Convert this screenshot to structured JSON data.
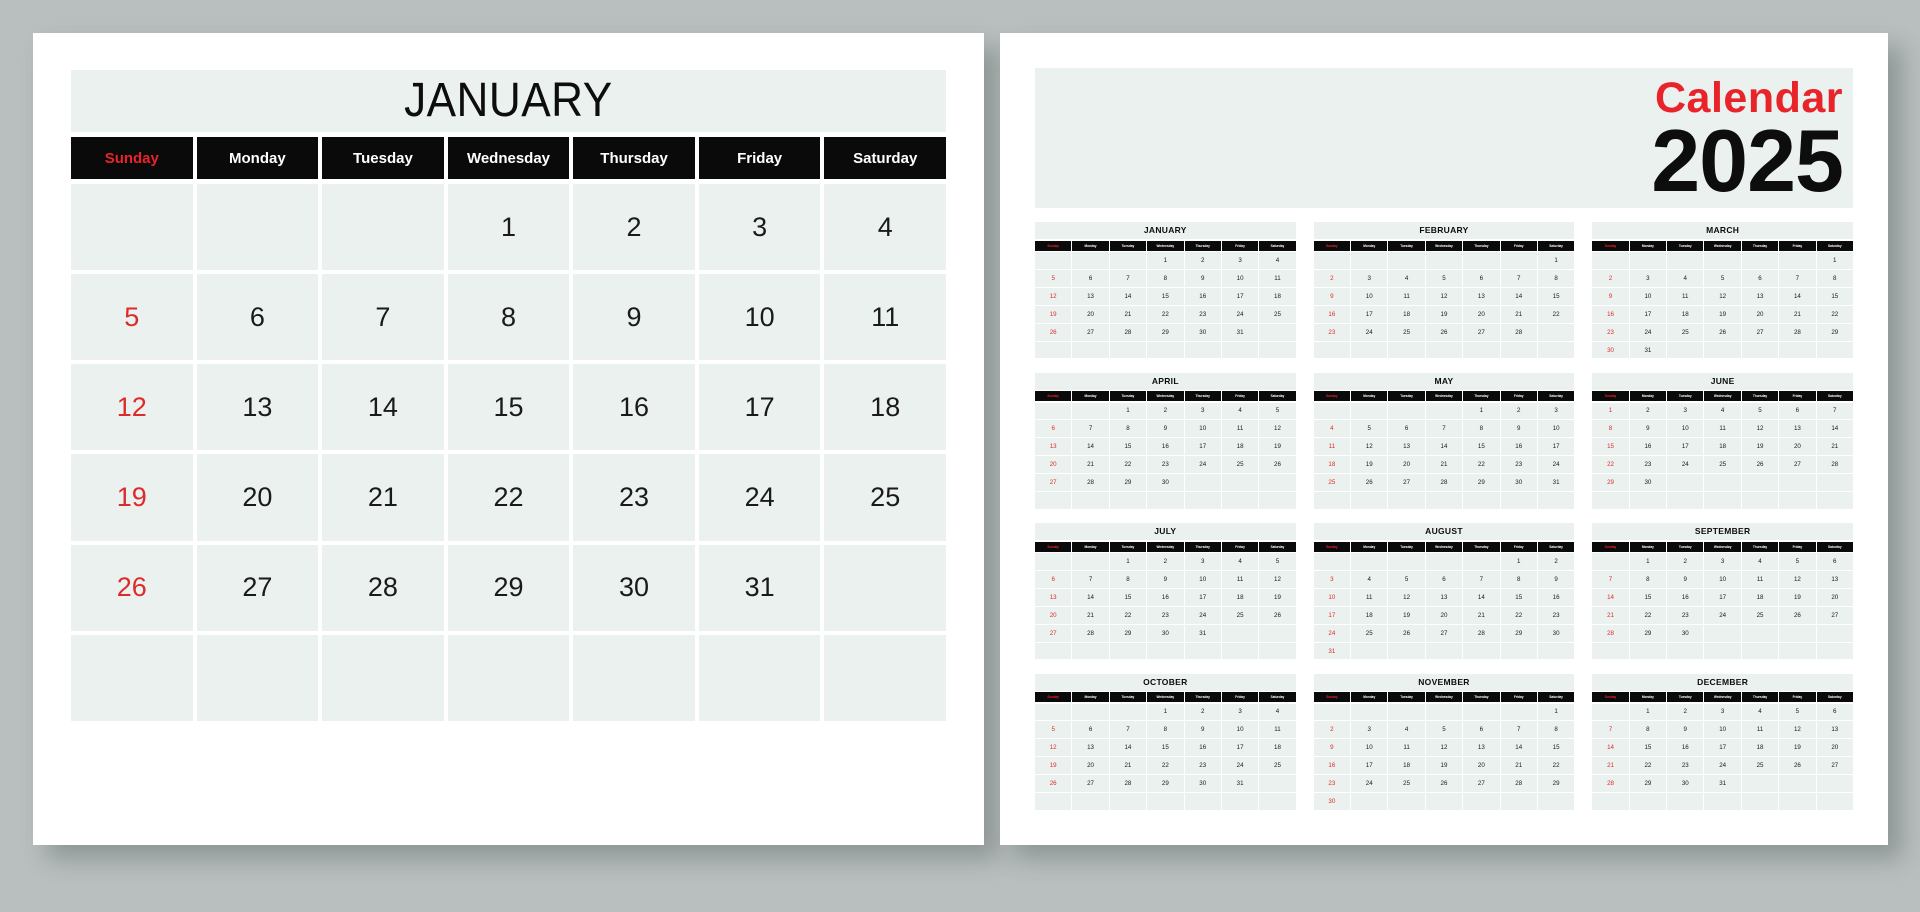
{
  "theme": {
    "background": "#b8bfbe",
    "card": "#ffffff",
    "cell": "#ebf1ef",
    "header_bar": "#0a0a0a",
    "accent_red": "#e8242a",
    "sunday_red": "#dc2b2b",
    "text": "#1a1a1a"
  },
  "main_month": {
    "title": "JANUARY",
    "weekdays": [
      "Sunday",
      "Monday",
      "Tuesday",
      "Wednesday",
      "Thursday",
      "Friday",
      "Saturday"
    ],
    "weeks": [
      [
        "",
        "",
        "",
        "1",
        "2",
        "3",
        "4"
      ],
      [
        "5",
        "6",
        "7",
        "8",
        "9",
        "10",
        "11"
      ],
      [
        "12",
        "13",
        "14",
        "15",
        "16",
        "17",
        "18"
      ],
      [
        "19",
        "20",
        "21",
        "22",
        "23",
        "24",
        "25"
      ],
      [
        "26",
        "27",
        "28",
        "29",
        "30",
        "31",
        ""
      ],
      [
        "",
        "",
        "",
        "",
        "",
        "",
        ""
      ]
    ]
  },
  "year_panel": {
    "word": "Calendar",
    "year": "2025",
    "mini_weekdays": [
      "Sunday",
      "Monday",
      "Tuesday",
      "Wednesday",
      "Thursday",
      "Friday",
      "Saturday"
    ],
    "months": [
      {
        "name": "JANUARY",
        "weeks": [
          [
            "",
            "",
            "",
            "1",
            "2",
            "3",
            "4"
          ],
          [
            "5",
            "6",
            "7",
            "8",
            "9",
            "10",
            "11"
          ],
          [
            "12",
            "13",
            "14",
            "15",
            "16",
            "17",
            "18"
          ],
          [
            "19",
            "20",
            "21",
            "22",
            "23",
            "24",
            "25"
          ],
          [
            "26",
            "27",
            "28",
            "29",
            "30",
            "31",
            ""
          ],
          [
            "",
            "",
            "",
            "",
            "",
            "",
            ""
          ]
        ]
      },
      {
        "name": "FEBRUARY",
        "weeks": [
          [
            "",
            "",
            "",
            "",
            "",
            "",
            "1"
          ],
          [
            "2",
            "3",
            "4",
            "5",
            "6",
            "7",
            "8"
          ],
          [
            "9",
            "10",
            "11",
            "12",
            "13",
            "14",
            "15"
          ],
          [
            "16",
            "17",
            "18",
            "19",
            "20",
            "21",
            "22"
          ],
          [
            "23",
            "24",
            "25",
            "26",
            "27",
            "28",
            ""
          ],
          [
            "",
            "",
            "",
            "",
            "",
            "",
            ""
          ]
        ]
      },
      {
        "name": "MARCH",
        "weeks": [
          [
            "",
            "",
            "",
            "",
            "",
            "",
            "1"
          ],
          [
            "2",
            "3",
            "4",
            "5",
            "6",
            "7",
            "8"
          ],
          [
            "9",
            "10",
            "11",
            "12",
            "13",
            "14",
            "15"
          ],
          [
            "16",
            "17",
            "18",
            "19",
            "20",
            "21",
            "22"
          ],
          [
            "23",
            "24",
            "25",
            "26",
            "27",
            "28",
            "29"
          ],
          [
            "30",
            "31",
            "",
            "",
            "",
            "",
            ""
          ]
        ]
      },
      {
        "name": "APRIL",
        "weeks": [
          [
            "",
            "",
            "1",
            "2",
            "3",
            "4",
            "5"
          ],
          [
            "6",
            "7",
            "8",
            "9",
            "10",
            "11",
            "12"
          ],
          [
            "13",
            "14",
            "15",
            "16",
            "17",
            "18",
            "19"
          ],
          [
            "20",
            "21",
            "22",
            "23",
            "24",
            "25",
            "26"
          ],
          [
            "27",
            "28",
            "29",
            "30",
            "",
            "",
            ""
          ],
          [
            "",
            "",
            "",
            "",
            "",
            "",
            ""
          ]
        ]
      },
      {
        "name": "MAY",
        "weeks": [
          [
            "",
            "",
            "",
            "",
            "1",
            "2",
            "3"
          ],
          [
            "4",
            "5",
            "6",
            "7",
            "8",
            "9",
            "10"
          ],
          [
            "11",
            "12",
            "13",
            "14",
            "15",
            "16",
            "17"
          ],
          [
            "18",
            "19",
            "20",
            "21",
            "22",
            "23",
            "24"
          ],
          [
            "25",
            "26",
            "27",
            "28",
            "29",
            "30",
            "31"
          ],
          [
            "",
            "",
            "",
            "",
            "",
            "",
            ""
          ]
        ]
      },
      {
        "name": "JUNE",
        "weeks": [
          [
            "1",
            "2",
            "3",
            "4",
            "5",
            "6",
            "7"
          ],
          [
            "8",
            "9",
            "10",
            "11",
            "12",
            "13",
            "14"
          ],
          [
            "15",
            "16",
            "17",
            "18",
            "19",
            "20",
            "21"
          ],
          [
            "22",
            "23",
            "24",
            "25",
            "26",
            "27",
            "28"
          ],
          [
            "29",
            "30",
            "",
            "",
            "",
            "",
            ""
          ],
          [
            "",
            "",
            "",
            "",
            "",
            "",
            ""
          ]
        ]
      },
      {
        "name": "JULY",
        "weeks": [
          [
            "",
            "",
            "1",
            "2",
            "3",
            "4",
            "5"
          ],
          [
            "6",
            "7",
            "8",
            "9",
            "10",
            "11",
            "12"
          ],
          [
            "13",
            "14",
            "15",
            "16",
            "17",
            "18",
            "19"
          ],
          [
            "20",
            "21",
            "22",
            "23",
            "24",
            "25",
            "26"
          ],
          [
            "27",
            "28",
            "29",
            "30",
            "31",
            "",
            ""
          ],
          [
            "",
            "",
            "",
            "",
            "",
            "",
            ""
          ]
        ]
      },
      {
        "name": "AUGUST",
        "weeks": [
          [
            "",
            "",
            "",
            "",
            "",
            "1",
            "2"
          ],
          [
            "3",
            "4",
            "5",
            "6",
            "7",
            "8",
            "9"
          ],
          [
            "10",
            "11",
            "12",
            "13",
            "14",
            "15",
            "16"
          ],
          [
            "17",
            "18",
            "19",
            "20",
            "21",
            "22",
            "23"
          ],
          [
            "24",
            "25",
            "26",
            "27",
            "28",
            "29",
            "30"
          ],
          [
            "31",
            "",
            "",
            "",
            "",
            "",
            ""
          ]
        ]
      },
      {
        "name": "SEPTEMBER",
        "weeks": [
          [
            "",
            "1",
            "2",
            "3",
            "4",
            "5",
            "6"
          ],
          [
            "7",
            "8",
            "9",
            "10",
            "11",
            "12",
            "13"
          ],
          [
            "14",
            "15",
            "16",
            "17",
            "18",
            "19",
            "20"
          ],
          [
            "21",
            "22",
            "23",
            "24",
            "25",
            "26",
            "27"
          ],
          [
            "28",
            "29",
            "30",
            "",
            "",
            "",
            ""
          ],
          [
            "",
            "",
            "",
            "",
            "",
            "",
            ""
          ]
        ]
      },
      {
        "name": "OCTOBER",
        "weeks": [
          [
            "",
            "",
            "",
            "1",
            "2",
            "3",
            "4"
          ],
          [
            "5",
            "6",
            "7",
            "8",
            "9",
            "10",
            "11"
          ],
          [
            "12",
            "13",
            "14",
            "15",
            "16",
            "17",
            "18"
          ],
          [
            "19",
            "20",
            "21",
            "22",
            "23",
            "24",
            "25"
          ],
          [
            "26",
            "27",
            "28",
            "29",
            "30",
            "31",
            ""
          ],
          [
            "",
            "",
            "",
            "",
            "",
            "",
            ""
          ]
        ]
      },
      {
        "name": "NOVEMBER",
        "weeks": [
          [
            "",
            "",
            "",
            "",
            "",
            "",
            "1"
          ],
          [
            "2",
            "3",
            "4",
            "5",
            "6",
            "7",
            "8"
          ],
          [
            "9",
            "10",
            "11",
            "12",
            "13",
            "14",
            "15"
          ],
          [
            "16",
            "17",
            "18",
            "19",
            "20",
            "21",
            "22"
          ],
          [
            "23",
            "24",
            "25",
            "26",
            "27",
            "28",
            "29"
          ],
          [
            "30",
            "",
            "",
            "",
            "",
            "",
            ""
          ]
        ]
      },
      {
        "name": "DECEMBER",
        "weeks": [
          [
            "",
            "1",
            "2",
            "3",
            "4",
            "5",
            "6"
          ],
          [
            "7",
            "8",
            "9",
            "10",
            "11",
            "12",
            "13"
          ],
          [
            "14",
            "15",
            "16",
            "17",
            "18",
            "19",
            "20"
          ],
          [
            "21",
            "22",
            "23",
            "24",
            "25",
            "26",
            "27"
          ],
          [
            "28",
            "29",
            "30",
            "31",
            "",
            "",
            ""
          ],
          [
            "",
            "",
            "",
            "",
            "",
            "",
            ""
          ]
        ]
      }
    ]
  }
}
